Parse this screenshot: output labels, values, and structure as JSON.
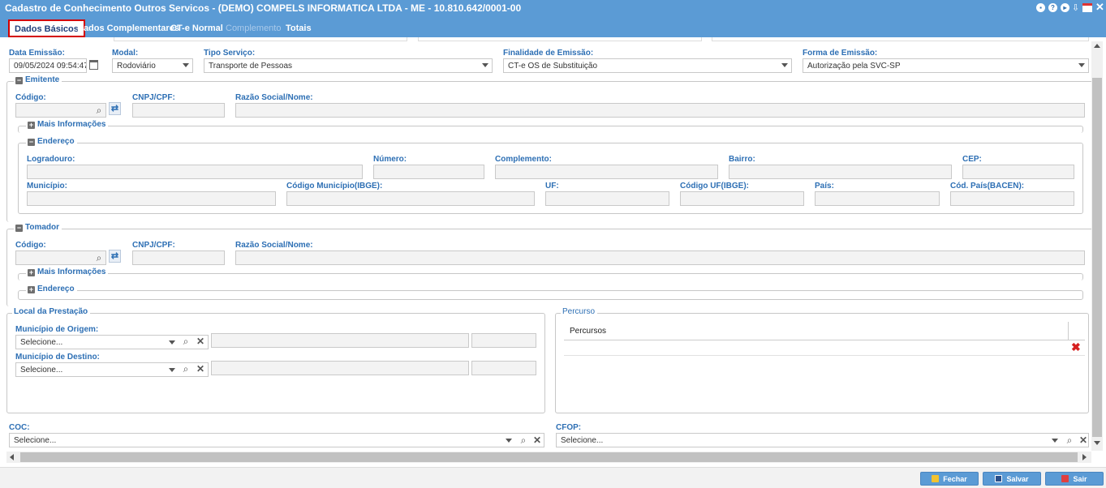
{
  "window": {
    "title": "Cadastro de Conhecimento Outros Servicos - (DEMO) COMPELS INFORMATICA LTDA - ME - 10.810.642/0001-00"
  },
  "tabs": [
    {
      "label": "Dados Básicos"
    },
    {
      "label": "Dados Complementares"
    },
    {
      "label": "CT-e Normal"
    },
    {
      "label": "Complemento"
    },
    {
      "label": "Totais"
    }
  ],
  "header_fields": {
    "data_emissao": {
      "label": "Data Emissão:",
      "value": "09/05/2024 09:54:47"
    },
    "modal": {
      "label": "Modal:",
      "value": "Rodoviário"
    },
    "tipo_servico": {
      "label": "Tipo Serviço:",
      "value": "Transporte de Pessoas"
    },
    "finalidade": {
      "label": "Finalidade de Emissão:",
      "value": "CT-e OS de Substituição"
    },
    "forma": {
      "label": "Forma de Emissão:",
      "value": "Autorização pela SVC-SP"
    }
  },
  "emitente": {
    "legend": "Emitente",
    "codigo_label": "Código:",
    "cnpj_label": "CNPJ/CPF:",
    "razao_label": "Razão Social/Nome:",
    "mais_info": "Mais Informações",
    "endereco": {
      "legend": "Endereço",
      "logradouro": "Logradouro:",
      "numero": "Número:",
      "complemento": "Complemento:",
      "bairro": "Bairro:",
      "cep": "CEP:",
      "municipio": "Município:",
      "codigo_municipio": "Código Município(IBGE):",
      "uf": "UF:",
      "codigo_uf": "Código UF(IBGE):",
      "pais": "País:",
      "cod_pais": "Cód. País(BACEN):"
    }
  },
  "tomador": {
    "legend": "Tomador",
    "codigo_label": "Código:",
    "cnpj_label": "CNPJ/CPF:",
    "razao_label": "Razão Social/Nome:",
    "mais_info": "Mais Informações",
    "endereco": "Endereço"
  },
  "local_prestacao": {
    "legend": "Local da Prestação",
    "origem_label": "Município de Origem:",
    "origem_value": "Selecione...",
    "destino_label": "Município de Destino:",
    "destino_value": "Selecione..."
  },
  "percurso": {
    "legend": "Percurso",
    "column": "Percursos"
  },
  "coc": {
    "label": "COC:",
    "value": "Selecione..."
  },
  "cfop": {
    "label": "CFOP:",
    "value": "Selecione..."
  },
  "buttons": {
    "fechar": "Fechar",
    "salvar": "Salvar",
    "sair": "Sair"
  },
  "colors": {
    "header_blue": "#5b9bd5",
    "label_blue": "#2d6fb4",
    "active_tab_border": "#d40000"
  }
}
